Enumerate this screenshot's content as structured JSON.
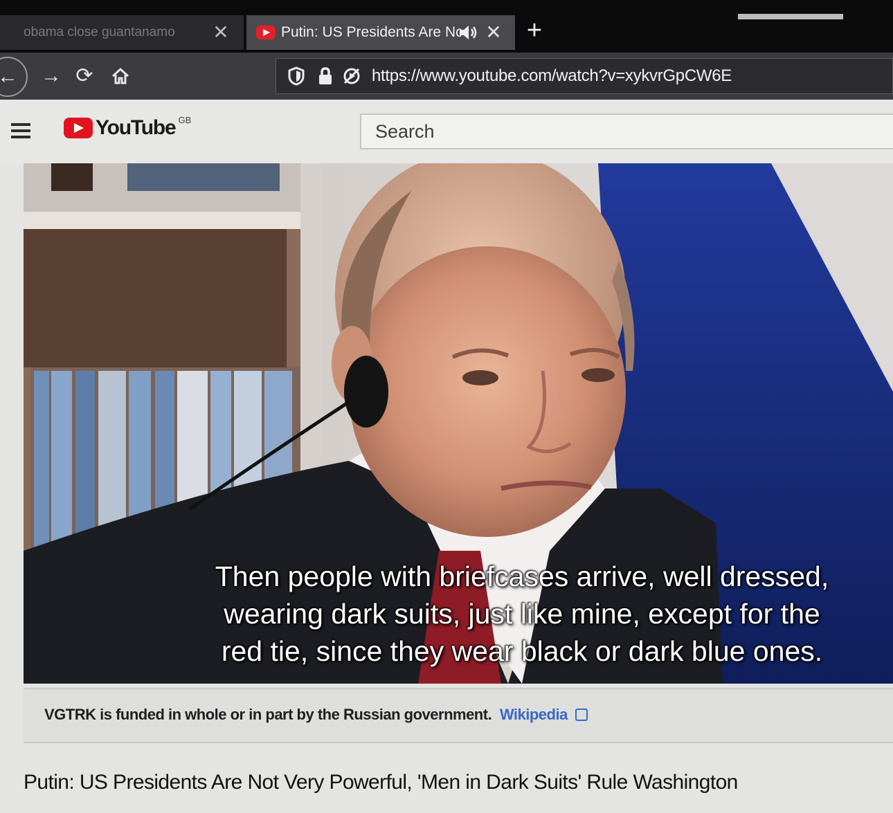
{
  "browser": {
    "tabs": [
      {
        "title": "obama close guantanamo",
        "close_glyph": "✕",
        "active": false
      },
      {
        "title": "Putin: US Presidents Are Not Very Powerful, 'Men in Dark Suits' Rule Washington",
        "close_glyph": "✕",
        "active": true,
        "audio": true
      }
    ],
    "new_tab_glyph": "+",
    "nav": {
      "back_glyph": "←",
      "forward_glyph": "→",
      "reload_glyph": "⟳",
      "home_icon": "home-icon"
    },
    "url": "https://www.youtube.com/watch?v=xykvrGpCW6E"
  },
  "youtube": {
    "logo_text": "YouTube",
    "region": "GB",
    "search": {
      "placeholder": "Search",
      "value": ""
    }
  },
  "video": {
    "captions": [
      "Then people with briefcases arrive, well dressed,",
      "wearing dark suits, just like mine, except for the",
      "red tie, since they wear black or dark blue ones."
    ]
  },
  "info_panel": {
    "text": "VGTRK is funded in whole or in part by the Russian government.",
    "link_label": "Wikipedia"
  },
  "video_title": "Putin: US Presidents Are Not Very Powerful, 'Men in Dark Suits' Rule Washington",
  "colors": {
    "youtube_red": "#e1141d",
    "link_blue": "#3a68c5",
    "browser_chrome": "#0b0b0c"
  }
}
